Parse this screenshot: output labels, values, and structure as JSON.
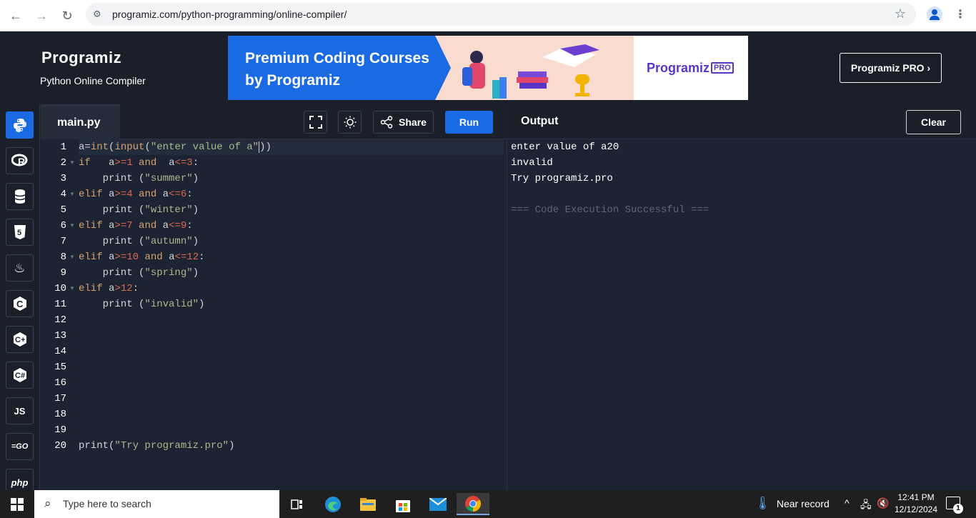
{
  "browser": {
    "url": "programiz.com/python-programming/online-compiler/"
  },
  "header": {
    "logo": "Programiz",
    "subtitle": "Python Online Compiler",
    "banner_title": "Premium Coding Courses by Programiz",
    "banner_brand": "Programiz",
    "banner_badge": "PRO",
    "pro_button": "Programiz PRO ›"
  },
  "languages": [
    {
      "name": "python",
      "icon": "python-icon",
      "active": true
    },
    {
      "name": "r",
      "icon": "r-icon",
      "label": "R"
    },
    {
      "name": "sql",
      "icon": "database-icon"
    },
    {
      "name": "html",
      "icon": "html5-icon",
      "label": "5"
    },
    {
      "name": "java",
      "icon": "java-icon",
      "label": "♨"
    },
    {
      "name": "c",
      "icon": "c-icon",
      "label": "C"
    },
    {
      "name": "cpp",
      "icon": "cpp-icon",
      "label": "C+"
    },
    {
      "name": "csharp",
      "icon": "csharp-icon",
      "label": "C#"
    },
    {
      "name": "javascript",
      "icon": "js-icon",
      "label": "JS"
    },
    {
      "name": "go",
      "icon": "go-icon",
      "label": "GO"
    },
    {
      "name": "php",
      "icon": "php-icon",
      "label": "php"
    }
  ],
  "editor": {
    "tab": "main.py",
    "share_label": "Share",
    "run_label": "Run",
    "line_numbers": [
      "1",
      "2",
      "3",
      "4",
      "5",
      "6",
      "7",
      "8",
      "9",
      "10",
      "11",
      "12",
      "13",
      "14",
      "15",
      "16",
      "17",
      "18",
      "19",
      "20"
    ],
    "code": [
      "a=int(input(\"enter value of a\"))",
      "if   a>=1 and  a<=3:",
      "    print (\"summer\")",
      "elif a>=4 and a<=6:",
      "    print (\"winter\")",
      "elif a>=7 and a<=9:",
      "    print (\"autumn\")",
      "elif a>=10 and a<=12:",
      "    print (\"spring\")",
      "elif a>12:",
      "    print (\"invalid\")",
      "",
      "",
      "",
      "",
      "",
      "",
      "",
      "",
      "print(\"Try programiz.pro\")"
    ]
  },
  "output": {
    "title": "Output",
    "clear_label": "Clear",
    "lines": [
      "enter value of a20",
      "invalid",
      "Try programiz.pro",
      "",
      "=== Code Execution Successful ==="
    ]
  },
  "taskbar": {
    "search_placeholder": "Type here to search",
    "weather": "Near record",
    "time": "12:41 PM",
    "date": "12/12/2024",
    "notifications": "1"
  }
}
